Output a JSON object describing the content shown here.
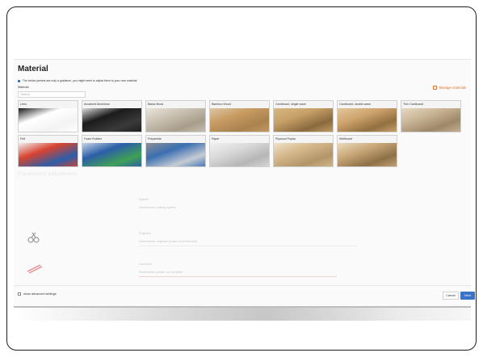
{
  "dialog": {
    "title": "Material",
    "hint": "The below presets are only a guidance, you might need to adjust them to your own material",
    "material_label": "Material",
    "manage_label": "Manage materials",
    "search_placeholder": "Search"
  },
  "materials": [
    {
      "label": "Lens",
      "colors": [
        "#ffffff",
        "#f3f3f3",
        "#1a1a1a"
      ]
    },
    {
      "label": "Anodized Aluminum",
      "colors": [
        "#1b1b1b",
        "#3a3a3a",
        "#dcdcdc"
      ]
    },
    {
      "label": "Balsa Wood",
      "colors": [
        "#c9c1b2",
        "#a89d8a",
        "#e9e4da"
      ]
    },
    {
      "label": "Bamboo Wood",
      "colors": [
        "#c89b62",
        "#a8824f",
        "#dcc7a8"
      ]
    },
    {
      "label": "Cardboard, single wave",
      "colors": [
        "#c7a068",
        "#8a6a3d",
        "#d8b885"
      ]
    },
    {
      "label": "Cardboard, double wave",
      "colors": [
        "#cfa46f",
        "#92703f",
        "#e2c79c"
      ]
    },
    {
      "label": "Thin Cardboard",
      "colors": [
        "#c9b596",
        "#9d8768",
        "#e6d9c3"
      ]
    },
    {
      "label": "Felt",
      "colors": [
        "#d8432f",
        "#2b5ea8",
        "#f0f0f0"
      ]
    },
    {
      "label": "Foam Rubber",
      "colors": [
        "#2b5ea8",
        "#3fa056",
        "#c5d3e4"
      ]
    },
    {
      "label": "Polyamide",
      "colors": [
        "#3b6fb0",
        "#c6ccd4",
        "#8c8f95"
      ]
    },
    {
      "label": "Paper",
      "colors": [
        "#d9d9d9",
        "#b6b6b6",
        "#f2f2f2"
      ]
    },
    {
      "label": "Plywood Poplar",
      "colors": [
        "#d5b88b",
        "#b3956a",
        "#efe1c9"
      ]
    },
    {
      "label": "Wellboard",
      "colors": [
        "#c9a878",
        "#8e7048",
        "#eadbc0"
      ]
    }
  ],
  "section_heading": "Parametric adjustment",
  "params": [
    {
      "name": "Speed",
      "value": "Determines cutting speed"
    },
    {
      "name": "Engrave",
      "value": "Determines engrave power and fineness"
    },
    {
      "name": "Cut lines",
      "value": "Determines power for cut lines"
    }
  ],
  "footer": {
    "advanced_label": "show advanced settings",
    "cancel_label": "Cancel",
    "next_label": "Next"
  }
}
